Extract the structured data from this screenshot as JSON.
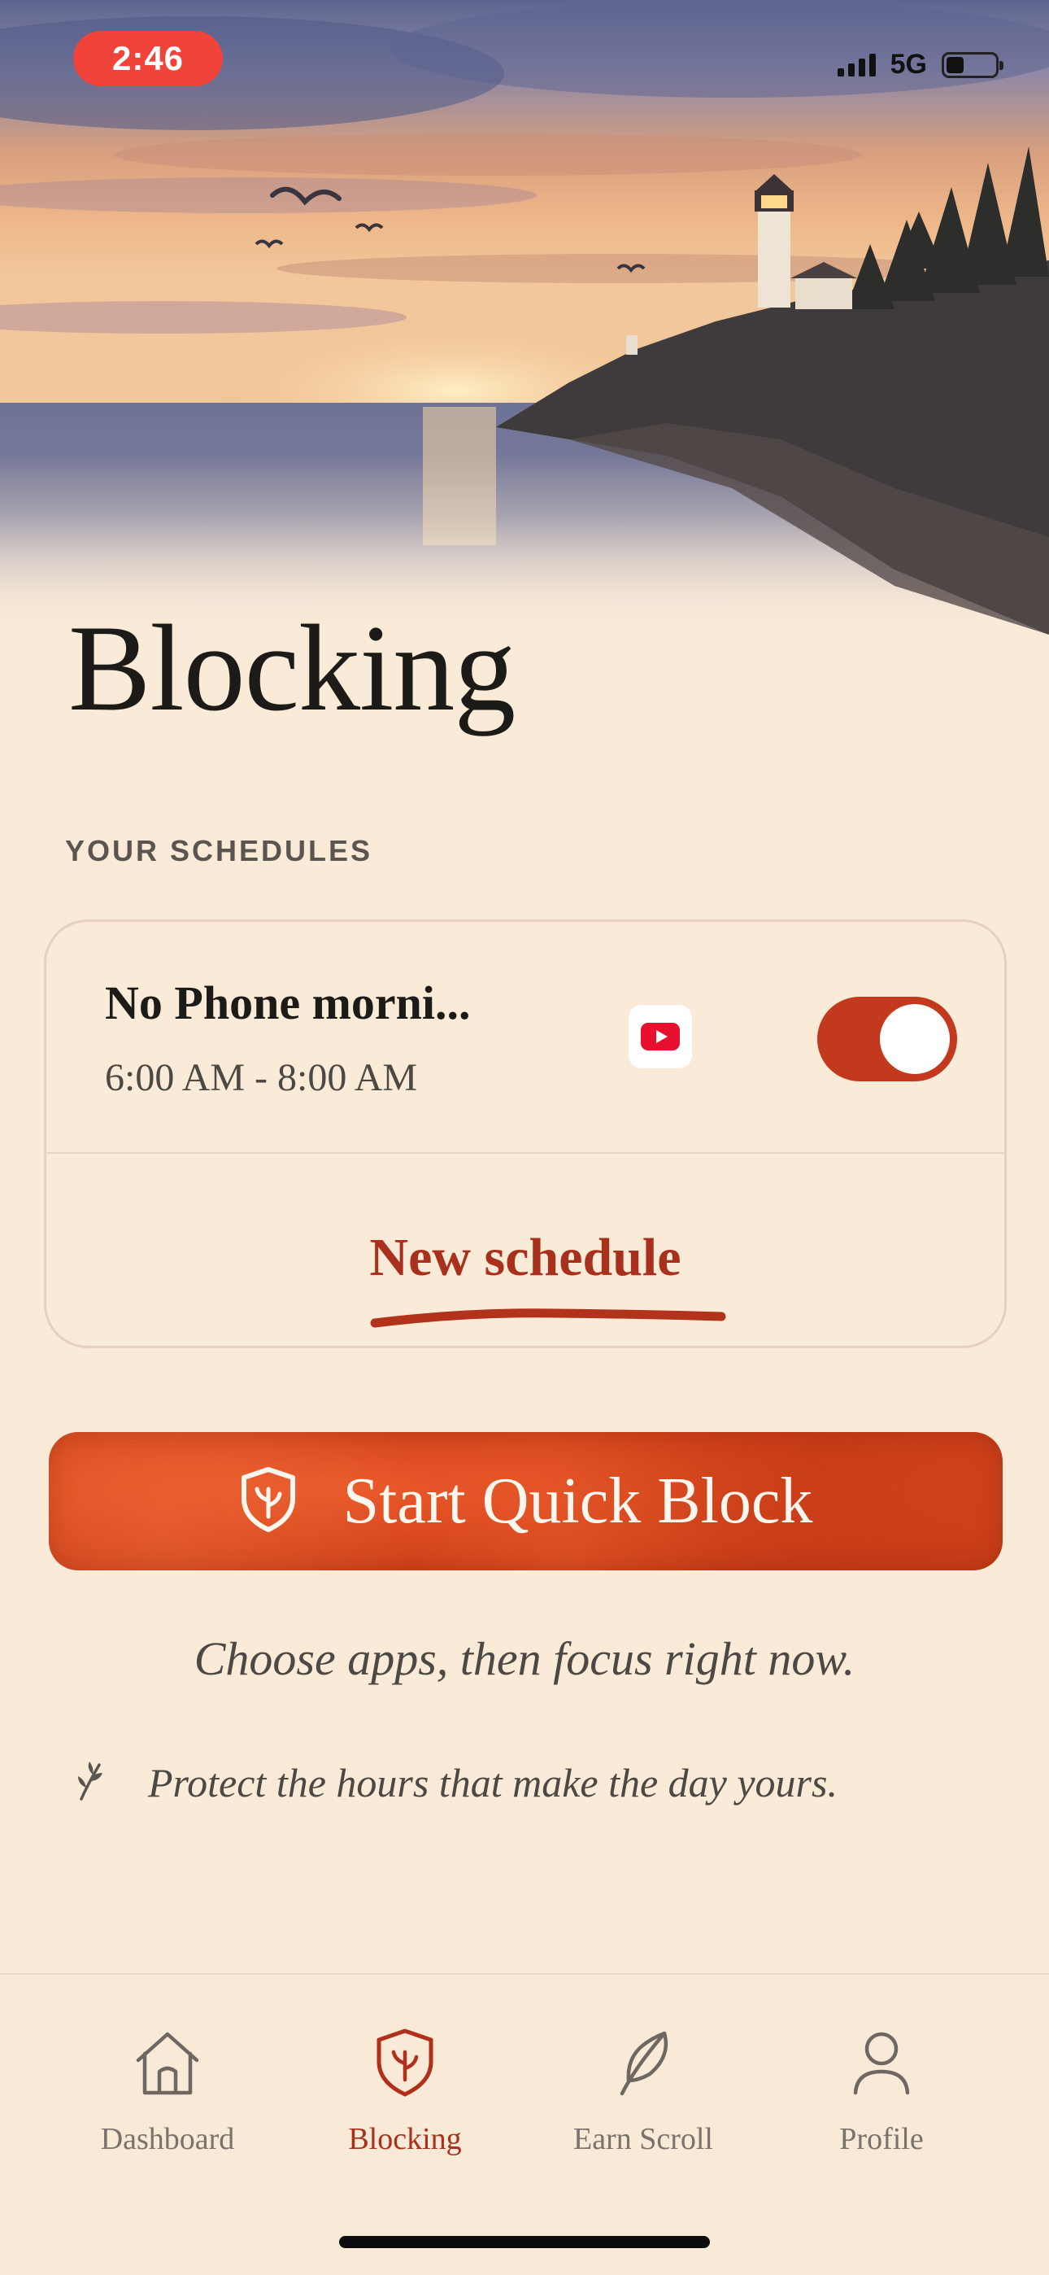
{
  "status_bar": {
    "time": "2:46",
    "network": "5G",
    "battery_level": 0.36
  },
  "page": {
    "title": "Blocking",
    "section_label": "YOUR SCHEDULES"
  },
  "schedules": [
    {
      "name": "No Phone morni...",
      "time_range": "6:00 AM - 8:00 AM",
      "app_icon": "youtube-icon",
      "enabled": true
    }
  ],
  "new_schedule_label": "New schedule",
  "quick_block": {
    "label": "Start Quick Block",
    "icon": "shield-sprout-icon",
    "hint": "Choose apps, then focus right now."
  },
  "motto": {
    "icon": "sprig-icon",
    "text": "Protect the hours that make the day yours."
  },
  "tabs": [
    {
      "label": "Dashboard",
      "icon": "home-icon",
      "active": false
    },
    {
      "label": "Blocking",
      "icon": "shield-sprout-icon",
      "active": true
    },
    {
      "label": "Earn Scroll",
      "icon": "feather-icon",
      "active": false
    },
    {
      "label": "Profile",
      "icon": "person-icon",
      "active": false
    }
  ],
  "colors": {
    "background": "#faebd8",
    "accent": "#c2391e",
    "accent_text": "#a8301c",
    "time_pill": "#f0443b",
    "text_primary": "#1d1b18",
    "text_secondary": "#4c4844"
  }
}
